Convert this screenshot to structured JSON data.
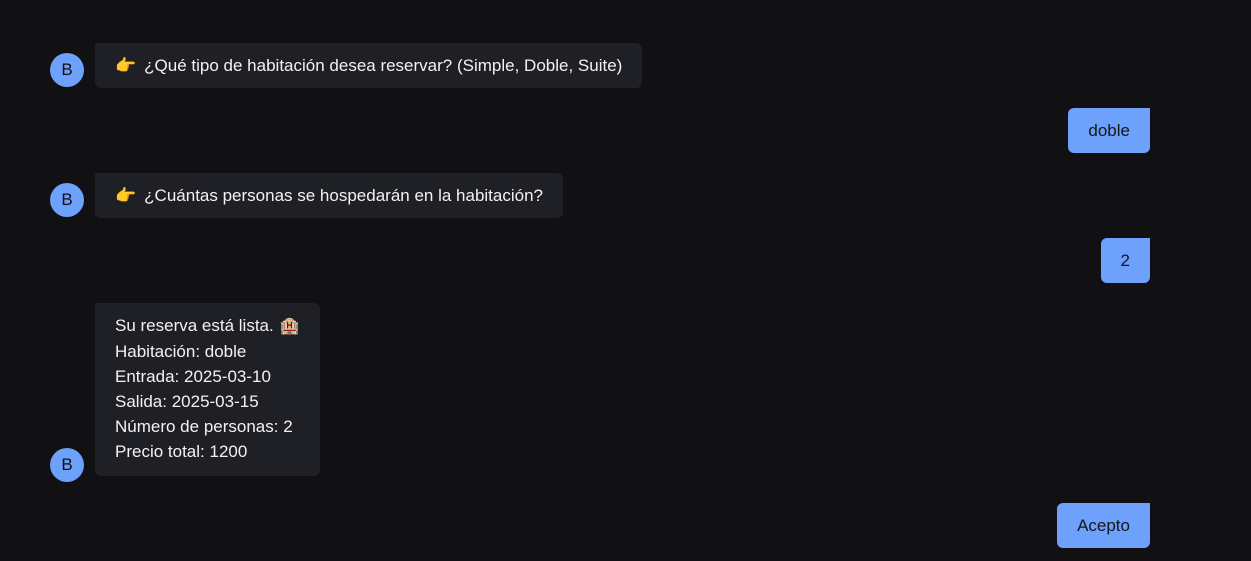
{
  "bot_avatar_letter": "B",
  "messages": [
    {
      "sender": "bot",
      "icon": "pointing-hand-icon",
      "icon_glyph": "👉",
      "text": "¿Qué tipo de habitación desea reservar? (Simple, Doble, Suite)"
    },
    {
      "sender": "user",
      "text": "doble"
    },
    {
      "sender": "bot",
      "icon": "pointing-hand-icon",
      "icon_glyph": "👉",
      "text": "¿Cuántas personas se hospedarán en la habitación?"
    },
    {
      "sender": "user",
      "text": "2"
    },
    {
      "sender": "bot",
      "lines": [
        "Su reserva está lista.",
        "Habitación: doble",
        "Entrada: 2025-03-10",
        "Salida: 2025-03-15",
        "Número de personas: 2",
        "Precio total: 1200"
      ],
      "trailing_icon": "hotel-icon",
      "trailing_icon_glyph": "🏨"
    },
    {
      "sender": "user",
      "text": "Acepto"
    }
  ],
  "colors": {
    "background": "#111114",
    "bot_bubble": "#1f2026",
    "user_bubble": "#6ea1fb",
    "avatar": "#6ea1fb"
  }
}
